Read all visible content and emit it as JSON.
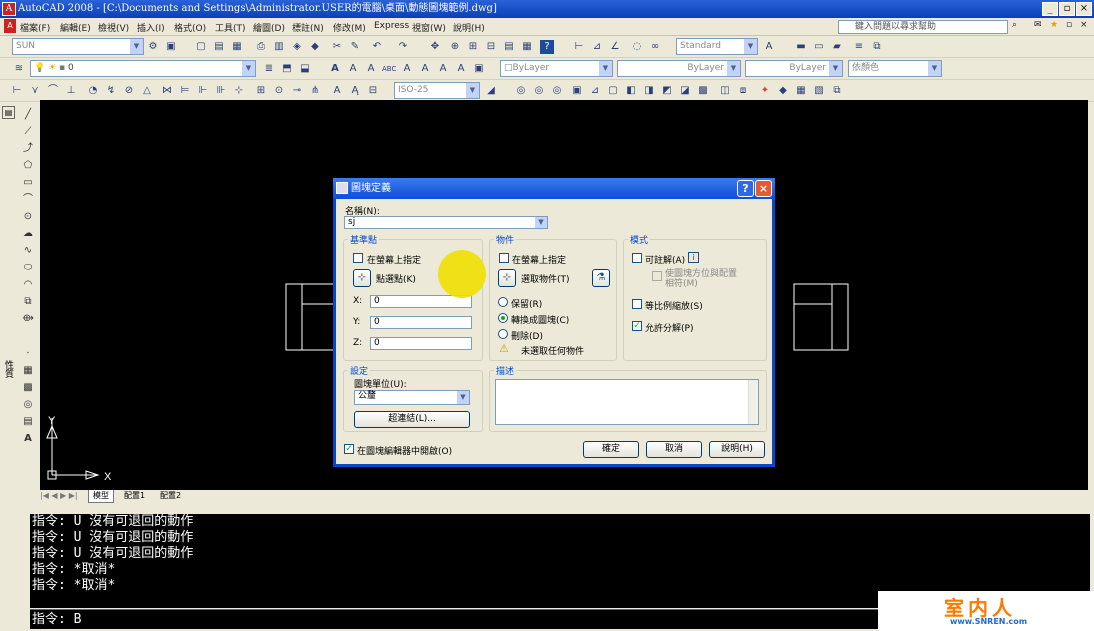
{
  "window": {
    "title": "AutoCAD 2008 - [C:\\Documents and Settings\\Administrator.USER的電腦\\桌面\\動態圖塊範例.dwg]"
  },
  "menu": [
    "檔案(F)",
    "編輯(E)",
    "檢視(V)",
    "插入(I)",
    "格式(O)",
    "工具(T)",
    "繪圖(D)",
    "標註(N)",
    "修改(M)",
    "Express",
    "視窗(W)",
    "說明(H)"
  ],
  "help_search": {
    "placeholder": "鍵入問題以尋求幫助"
  },
  "toolbars": {
    "workspace": "SUN",
    "layer": "0",
    "textstyle": "Standard",
    "color": "ByLayer",
    "linetype": "ByLayer",
    "lineweight": "ByLayer",
    "plotstyle": "依顏色",
    "dimstyle": "ISO-25"
  },
  "sidebar": {
    "label": "性質"
  },
  "drawing": {
    "axis_y": "Y",
    "axis_x": "X"
  },
  "tabs": [
    "模型",
    "配置1",
    "配置2"
  ],
  "command": {
    "history": [
      "指令: U 沒有可退回的動作",
      "指令: U 沒有可退回的動作",
      "指令: U 沒有可退回的動作",
      "指令: *取消*",
      "指令: *取消*"
    ],
    "prompt": "指令: B"
  },
  "watermark": {
    "main": "室内人",
    "sub": "www.SNREN.com"
  },
  "dialog": {
    "title": "圖塊定義",
    "name_label": "名稱(N):",
    "name_value": "sj",
    "base_point": {
      "title": "基準點",
      "specify_label": "在螢幕上指定",
      "pick_label": "點選點(K)",
      "x_label": "X:",
      "x": "0",
      "y_label": "Y:",
      "y": "0",
      "z_label": "Z:",
      "z": "0"
    },
    "objects": {
      "title": "物件",
      "specify_label": "在螢幕上指定",
      "select_label": "選取物件(T)",
      "retain": "保留(R)",
      "convert": "轉換成圖塊(C)",
      "delete": "刪除(D)",
      "warning": "未選取任何物件"
    },
    "behavior": {
      "title": "模式",
      "annotative": "可註解(A)",
      "match_orient": "使圖塊方位與配置相符(M)",
      "scale_uniform": "等比例縮放(S)",
      "allow_explode": "允許分解(P)"
    },
    "settings": {
      "title": "設定",
      "unit_label": "圖塊單位(U):",
      "unit_value": "公釐",
      "hyperlink": "超連結(L)..."
    },
    "description": {
      "title": "描述"
    },
    "open_editor": "在圖塊編輯器中開啟(O)",
    "ok": "確定",
    "cancel": "取消",
    "help": "說明(H)"
  },
  "colors": {
    "titlebar": "#0b4fd8",
    "canvas": "#000000",
    "dialog_bg": "#ece9d8",
    "highlight": "#f0e000"
  }
}
